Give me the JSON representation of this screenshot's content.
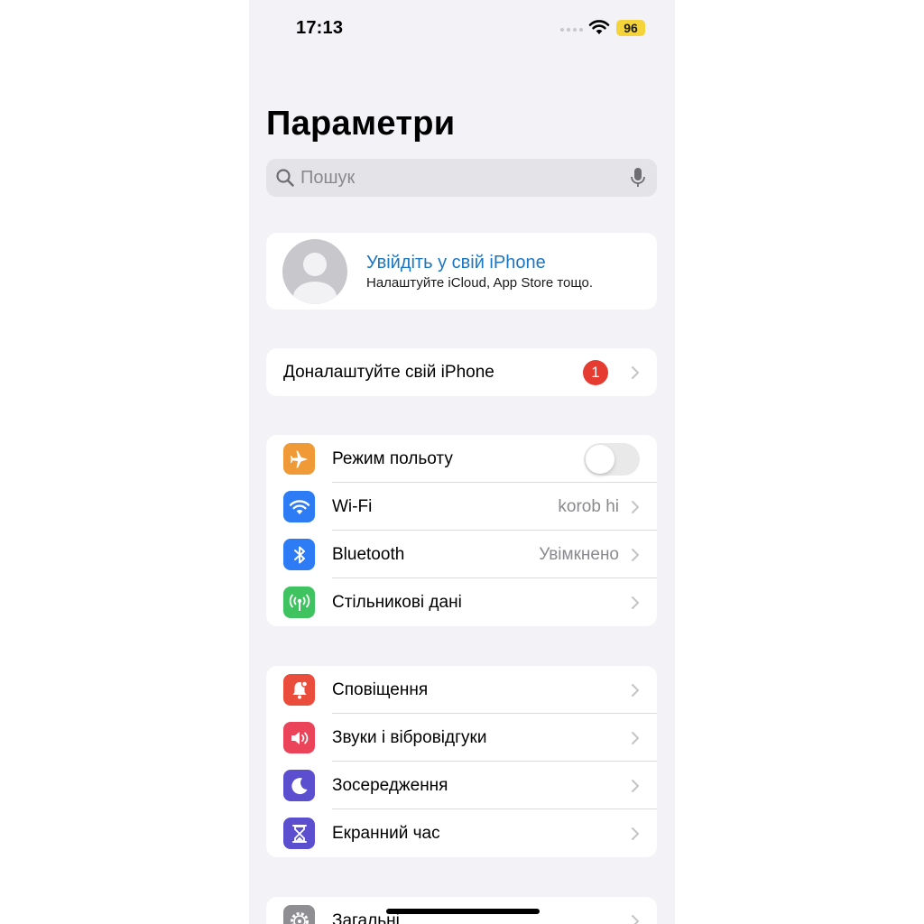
{
  "status_bar": {
    "time": "17:13",
    "battery_level": "96",
    "battery_color": "#f5d33a"
  },
  "title": "Параметри",
  "search": {
    "placeholder": "Пошук",
    "value": ""
  },
  "account": {
    "title": "Увійдіть у свій iPhone",
    "subtitle": "Налаштуйте iCloud, App Store тощо.",
    "title_color": "#1b76c3"
  },
  "finish_setup": {
    "label": "Доналаштуйте свій iPhone",
    "badge": "1",
    "badge_color": "#e63b30"
  },
  "connectivity": [
    {
      "label": "Режим польоту",
      "icon": "airplane-icon",
      "color": "#f09a37",
      "value": "",
      "toggle": false
    },
    {
      "label": "Wi-Fi",
      "icon": "wifi-icon",
      "color": "#2d7cf6",
      "value": "korob hi"
    },
    {
      "label": "Bluetooth",
      "icon": "bluetooth-icon",
      "color": "#2d7cf6",
      "value": "Увімкнено"
    },
    {
      "label": "Стільникові дані",
      "icon": "antenna-icon",
      "color": "#3fc360",
      "value": ""
    }
  ],
  "alerts": [
    {
      "label": "Сповіщення",
      "icon": "bell-icon",
      "color": "#eb4d3d"
    },
    {
      "label": "Звуки і вібровідгуки",
      "icon": "speaker-icon",
      "color": "#eb445a"
    },
    {
      "label": "Зосередження",
      "icon": "moon-icon",
      "color": "#5b4fcf"
    },
    {
      "label": "Екранний час",
      "icon": "hourglass-icon",
      "color": "#5b4fcf"
    }
  ],
  "general": {
    "label": "Загальні",
    "icon": "gear-icon",
    "color": "#8e8e93"
  }
}
